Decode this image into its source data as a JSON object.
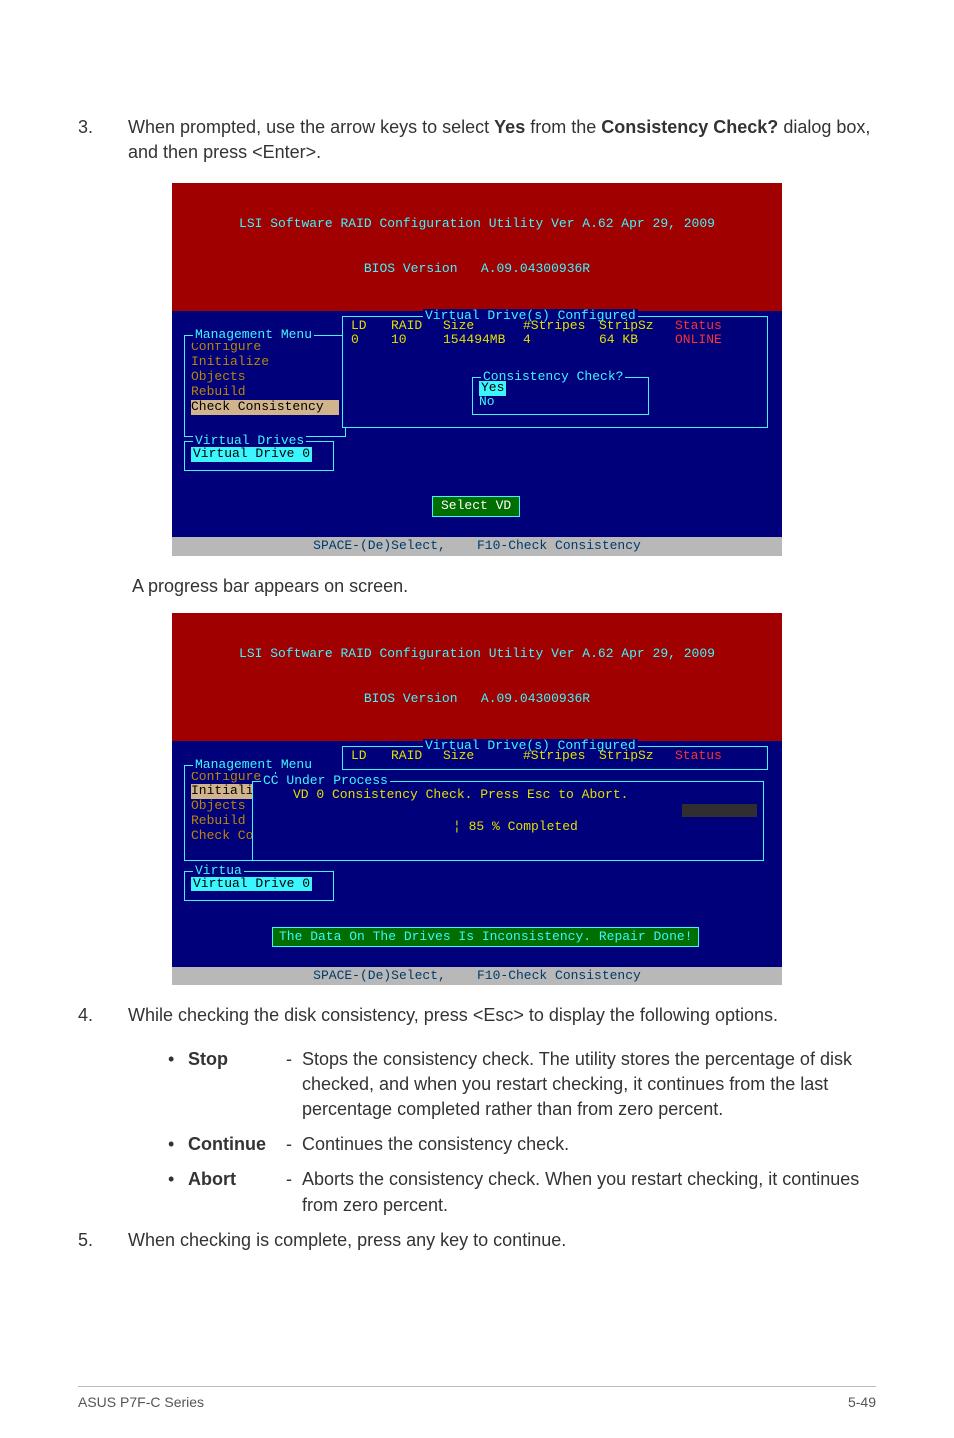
{
  "step3": {
    "num": "3.",
    "text_pre": "When prompted, use the arrow keys to select ",
    "yes": "Yes",
    "text_mid": " from the ",
    "cc": "Consistency Check?",
    "text_post": " dialog box, and then press <Enter>."
  },
  "term1": {
    "title_l1": "LSI Software RAID Configuration Utility Ver A.62 Apr 29, 2009",
    "title_l2": "BIOS Version   A.09.04300936R",
    "mgmt_label": "Management Menu",
    "mgmt": [
      "Configure",
      "Initialize",
      "Objects",
      "Rebuild",
      "Check Consistency"
    ],
    "vd_label": "Virtual Drives",
    "vd_item": "Virtual Drive 0",
    "big_label": "Virtual Drive(s) Configured",
    "hdr": {
      "ld": "LD",
      "raid": "RAID",
      "size": "Size",
      "str": "#Stripes",
      "ssz": "StripSz",
      "st": "Status"
    },
    "row": {
      "ld": "0",
      "raid": "10",
      "size": "154494MB",
      "str": "4",
      "ssz": "64 KB",
      "st": "ONLINE"
    },
    "cons_label": "Consistency Check?",
    "cons_yes": "Yes",
    "cons_no": "No",
    "select_vd": "Select VD",
    "footer": "SPACE-(De)Select,    F10-Check Consistency"
  },
  "progress_note": "A progress bar appears on screen.",
  "term2": {
    "title_l1": "LSI Software RAID Configuration Utility Ver A.62 Apr 29, 2009",
    "title_l2": "BIOS Version   A.09.04300936R",
    "mgmt_label": "Management Menu",
    "mgmt_short": [
      "Configure",
      "Initiali",
      "Objects",
      "Rebuild",
      "Check Co"
    ],
    "big_label": "Virtual Drive(s) Configured",
    "hdr": {
      "ld": "LD",
      "raid": "RAID",
      "size": "Size",
      "str": "#Stripes",
      "ssz": "StripSz",
      "st": "Status"
    },
    "cc_label": "CC Under Process",
    "cc_msg": "VD 0 Consistency Check. Press Esc to Abort.",
    "cc_pct": "¦ 85 % Completed",
    "vd_label": "Virtua",
    "vd_item": "Virtual Drive 0",
    "done": "The Data On The Drives Is Inconsistency. Repair Done!",
    "footer": "SPACE-(De)Select,    F10-Check Consistency"
  },
  "step4": {
    "num": "4.",
    "text": "While checking the disk consistency, press <Esc> to display the following options.",
    "opts": {
      "stop_l": "Stop",
      "stop_t": "Stops the consistency check. The utility stores the percentage of disk checked, and when you restart checking, it continues from the last percentage completed rather than from zero percent.",
      "cont_l": "Continue",
      "cont_t": "Continues the consistency check.",
      "abort_l": "Abort",
      "abort_t": "Aborts the consistency check. When you restart checking, it continues from zero percent."
    }
  },
  "step5": {
    "num": "5.",
    "text": "When checking is complete, press any key to continue."
  },
  "footer": {
    "left": "ASUS P7F-C Series",
    "right": "5-49"
  }
}
